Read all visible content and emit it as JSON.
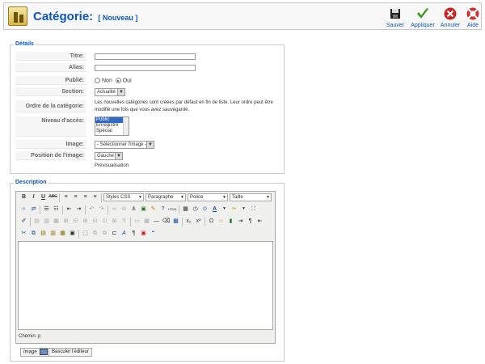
{
  "header": {
    "title": "Catégorie:",
    "subtitle": "[ Nouveau ]"
  },
  "toolbar": {
    "buttons": [
      {
        "label": "Sauver",
        "icon": "save-icon"
      },
      {
        "label": "Appliquer",
        "icon": "apply-icon"
      },
      {
        "label": "Annuler",
        "icon": "cancel-icon"
      },
      {
        "label": "Aide",
        "icon": "help-icon"
      }
    ]
  },
  "details": {
    "legend": "Détails",
    "titre_label": "Titre:",
    "titre_value": "",
    "alias_label": "Alias:",
    "alias_value": "",
    "publie_label": "Publié:",
    "publie_options": [
      "Non",
      "Oui"
    ],
    "publie_selected": "Oui",
    "section_label": "Section:",
    "section_value": "Actualité",
    "ordre_label": "Ordre de la catégorie:",
    "ordre_text": "Les nouvelles catégories sont créées par défaut en fin de liste. Leur ordre peut être modifié une fois que vous avez sauvegardé.",
    "niveau_label": "Niveau d'accès:",
    "niveau_options": [
      "Public",
      "Enregistré",
      "Spécial"
    ],
    "niveau_selected": "Public",
    "image_label": "Image:",
    "image_value": "- Sélectionner l'image -",
    "position_label": "Position de l'image:",
    "position_value": "Gauche",
    "preview_label": "Prévisualisation"
  },
  "description": {
    "legend": "Description",
    "editor": {
      "selects": {
        "styles": "Styles CSS",
        "format": "Paragraphe",
        "font": "Police",
        "size": "Taille"
      },
      "path": "Chemin: p",
      "content": ""
    },
    "buttons": {
      "image": "Image",
      "toggle": "Basculer l'éditeur"
    }
  },
  "colors": {
    "accent": "#0b55c4",
    "save": "#222222",
    "apply": "#3a9a1e",
    "cancel": "#cc2222",
    "help": "#d03030"
  }
}
